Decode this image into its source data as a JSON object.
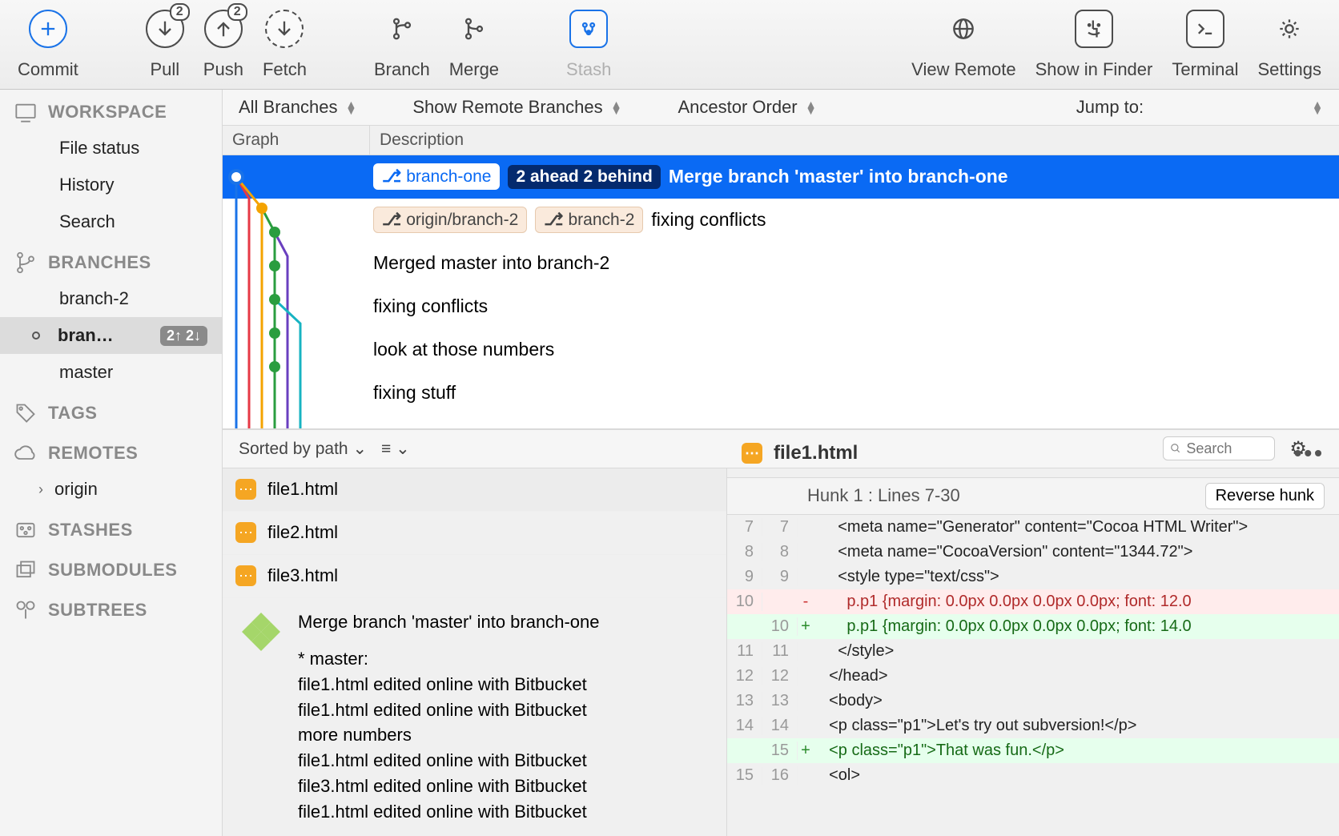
{
  "toolbar": {
    "commit": "Commit",
    "pull": "Pull",
    "pull_badge": "2",
    "push": "Push",
    "push_badge": "2",
    "fetch": "Fetch",
    "branch": "Branch",
    "merge": "Merge",
    "stash": "Stash",
    "view_remote": "View Remote",
    "show_in_finder": "Show in Finder",
    "terminal": "Terminal",
    "settings": "Settings"
  },
  "sidebar": {
    "workspace": {
      "header": "WORKSPACE",
      "items": [
        "File status",
        "History",
        "Search"
      ]
    },
    "branches": {
      "header": "BRANCHES",
      "items": [
        {
          "name": "branch-2",
          "active": false,
          "ahead_behind": ""
        },
        {
          "name": "bran…",
          "active": true,
          "ahead_behind": "2↑ 2↓"
        },
        {
          "name": "master",
          "active": false,
          "ahead_behind": ""
        }
      ]
    },
    "tags": {
      "header": "TAGS"
    },
    "remotes": {
      "header": "REMOTES",
      "items": [
        "origin"
      ]
    },
    "stashes": {
      "header": "STASHES"
    },
    "submodules": {
      "header": "SUBMODULES"
    },
    "subtrees": {
      "header": "SUBTREES"
    }
  },
  "filters": {
    "branch_scope": "All Branches",
    "remote_toggle": "Show Remote Branches",
    "order": "Ancestor Order",
    "jump": "Jump to:"
  },
  "columns": {
    "graph": "Graph",
    "description": "Description"
  },
  "commits": [
    {
      "selected": true,
      "tags": [
        {
          "label": "branch-one",
          "selected": true
        }
      ],
      "ahead_behind": "2 ahead 2 behind",
      "message": "Merge branch 'master' into branch-one"
    },
    {
      "selected": false,
      "tags": [
        {
          "label": "origin/branch-2"
        },
        {
          "label": "branch-2"
        }
      ],
      "message": "fixing conflicts"
    },
    {
      "selected": false,
      "tags": [],
      "message": "Merged master into branch-2"
    },
    {
      "selected": false,
      "tags": [],
      "message": "fixing conflicts"
    },
    {
      "selected": false,
      "tags": [],
      "message": "look at those numbers"
    },
    {
      "selected": false,
      "tags": [],
      "message": "fixing stuff"
    }
  ],
  "detail_toolbar": {
    "sort": "Sorted by path",
    "search_placeholder": "Search"
  },
  "files": [
    "file1.html",
    "file2.html",
    "file3.html"
  ],
  "commit_detail": {
    "title": "Merge branch 'master' into branch-one",
    "lines": [
      "* master:",
      "file1.html edited online with Bitbucket",
      "file1.html edited online with Bitbucket",
      "more numbers",
      "file1.html edited online with Bitbucket",
      "file3.html edited online with Bitbucket",
      "file1.html edited online with Bitbucket"
    ]
  },
  "diff": {
    "file": "file1.html",
    "hunk_header": "Hunk 1 : Lines 7-30",
    "reverse": "Reverse hunk",
    "lines": [
      {
        "a": "7",
        "b": "7",
        "t": "ctx",
        "code": "    <meta name=\"Generator\" content=\"Cocoa HTML Writer\">"
      },
      {
        "a": "8",
        "b": "8",
        "t": "ctx",
        "code": "    <meta name=\"CocoaVersion\" content=\"1344.72\">"
      },
      {
        "a": "9",
        "b": "9",
        "t": "ctx",
        "code": "    <style type=\"text/css\">"
      },
      {
        "a": "10",
        "b": "",
        "t": "del",
        "code": "      p.p1 {margin: 0.0px 0.0px 0.0px 0.0px; font: 12.0"
      },
      {
        "a": "",
        "b": "10",
        "t": "add",
        "code": "      p.p1 {margin: 0.0px 0.0px 0.0px 0.0px; font: 14.0"
      },
      {
        "a": "11",
        "b": "11",
        "t": "ctx",
        "code": "    </style>"
      },
      {
        "a": "12",
        "b": "12",
        "t": "ctx",
        "code": "  </head>"
      },
      {
        "a": "13",
        "b": "13",
        "t": "ctx",
        "code": "  <body>"
      },
      {
        "a": "14",
        "b": "14",
        "t": "ctx",
        "code": "  <p class=\"p1\">Let's try out subversion!</p>"
      },
      {
        "a": "",
        "b": "15",
        "t": "add",
        "code": "  <p class=\"p1\">That was fun.</p>"
      },
      {
        "a": "15",
        "b": "16",
        "t": "ctx",
        "code": "  <ol>"
      }
    ]
  }
}
